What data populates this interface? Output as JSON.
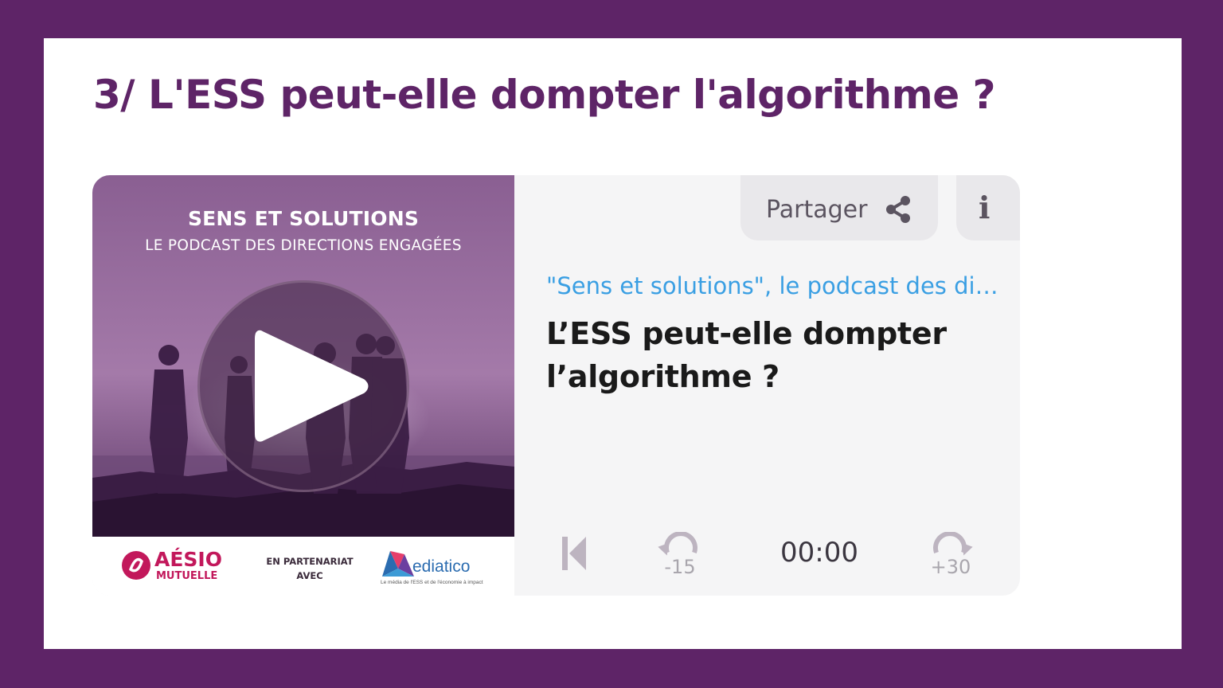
{
  "page": {
    "heading": "3/ L'ESS peut-elle dompter l'algorithme ?"
  },
  "cover": {
    "title": "SENS ET SOLUTIONS",
    "subtitle": "LE PODCAST DES DIRECTIONS ENGAGÉES",
    "brand_left_name": "AÉSIO",
    "brand_left_sub": "MUTUELLE",
    "partnership_line1": "EN PARTENARIAT",
    "partnership_line2": "AVEC",
    "brand_right_name": "ediatico",
    "brand_right_tagline": "Le média de l'ESS et de l'économie à impact"
  },
  "player": {
    "share_label": "Partager",
    "info_label": "i",
    "show_title": "\"Sens et solutions\", le podcast des directions engagées",
    "episode_title": "L’ESS peut-elle dompter l’algorithme ?",
    "rewind_label": "-15",
    "forward_label": "+30",
    "time": "00:00"
  },
  "icons": {
    "play": "play-icon",
    "share": "share-icon",
    "info": "info-icon",
    "skip_back": "skip-back-icon",
    "rewind": "rewind-icon",
    "forward": "forward-icon"
  },
  "colors": {
    "frame": "#5e2467",
    "heading": "#5e2467",
    "show_title": "#3a9fe3",
    "brand_pink": "#c2185b"
  }
}
